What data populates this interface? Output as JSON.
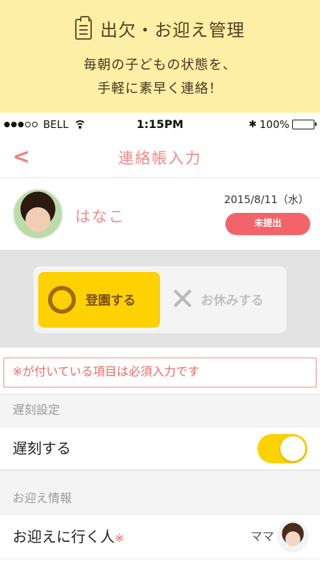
{
  "banner": {
    "icon": "clipboard-icon",
    "title": "出欠・お迎え管理",
    "line1": "毎朝の子どもの状態を、",
    "line2": "手軽に素早く連絡！"
  },
  "status_bar": {
    "carrier": "BELL",
    "time": "1:15PM",
    "battery": "100%",
    "battery_level": 1.0
  },
  "nav": {
    "back_icon": "chevron-left-icon",
    "back_glyph": "<",
    "title": "連絡帳入力"
  },
  "child": {
    "name": "はなこ",
    "date": "2015/8/11（水）",
    "status_badge": "未提出"
  },
  "attendance": {
    "attend_label": "登園する",
    "attend_icon": "circle-icon",
    "absent_label": "お休みする",
    "absent_icon": "x-mark-icon",
    "absent_glyph": "✕",
    "selected": "attend"
  },
  "notice": "※が付いている項目は必須入力です",
  "late": {
    "section_title": "遅刻設定",
    "row_label": "遅刻する",
    "toggle_on": true
  },
  "pickup": {
    "section_title": "お迎え情報",
    "row_label": "お迎えに行く人",
    "required_mark": "※",
    "value": "ママ"
  },
  "colors": {
    "banner_bg": "#fdf0a6",
    "accent_pink": "#ef8a8a",
    "badge_red": "#f26469",
    "accent_yellow": "#fed100"
  }
}
